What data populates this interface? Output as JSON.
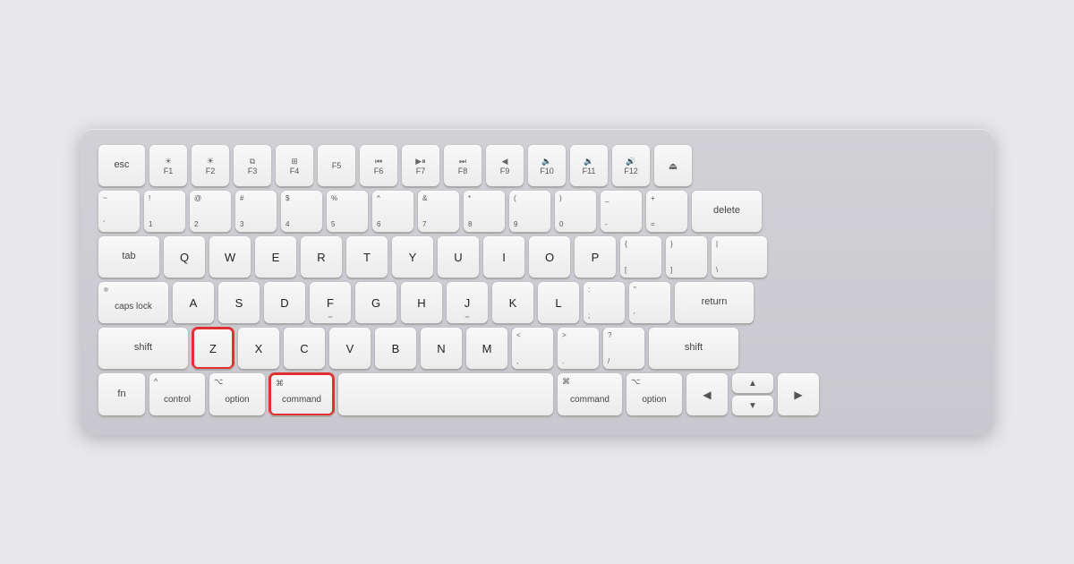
{
  "keyboard": {
    "highlighted_keys": [
      "Z",
      "command-left"
    ],
    "rows": {
      "fn_row": [
        {
          "id": "esc",
          "label": "esc",
          "width": "esc"
        },
        {
          "id": "f1",
          "top": "☀",
          "bottom": "F1",
          "width": "fn"
        },
        {
          "id": "f2",
          "top": "☀",
          "bottom": "F2",
          "width": "fn"
        },
        {
          "id": "f3",
          "top": "⊞",
          "bottom": "F3",
          "width": "fn"
        },
        {
          "id": "f4",
          "top": "⊞⊞",
          "bottom": "F4",
          "width": "fn"
        },
        {
          "id": "f5",
          "bottom": "F5",
          "width": "fn"
        },
        {
          "id": "f6",
          "top": "⏮",
          "bottom": "F6",
          "width": "fn"
        },
        {
          "id": "f7",
          "top": "⏯",
          "bottom": "F7",
          "width": "fn"
        },
        {
          "id": "f8",
          "top": "⏭",
          "bottom": "F8",
          "width": "fn"
        },
        {
          "id": "f9",
          "top": "◀",
          "bottom": "F9",
          "width": "fn"
        },
        {
          "id": "f10",
          "top": "🔈",
          "bottom": "F10",
          "width": "fn"
        },
        {
          "id": "f11",
          "top": "🔉",
          "bottom": "F11",
          "width": "fn"
        },
        {
          "id": "f12",
          "top": "🔊",
          "bottom": "F12",
          "width": "fn"
        },
        {
          "id": "eject",
          "top": "⏏",
          "bottom": "",
          "width": "fn"
        }
      ]
    }
  }
}
